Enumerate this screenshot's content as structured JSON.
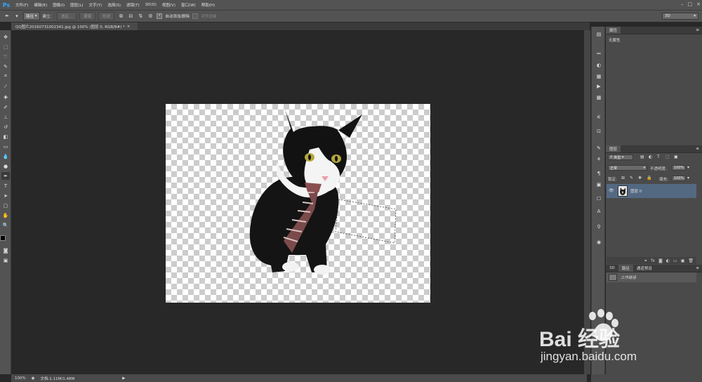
{
  "app": {
    "logo": "Ps"
  },
  "menu": [
    "文件(F)",
    "编辑(E)",
    "图像(I)",
    "图层(L)",
    "文字(Y)",
    "选择(S)",
    "滤镜(T)",
    "3D(D)",
    "视图(V)",
    "窗口(W)",
    "帮助(H)"
  ],
  "window_controls": [
    "–",
    "□",
    "×"
  ],
  "options": {
    "mode_select": "路径",
    "make_label": "建立：",
    "selection_btn": "选区...",
    "mask_btn": "蒙版",
    "shape_btn": "形状",
    "auto_add_label": "自动添加/删除",
    "align_edges_label": "对齐边缘",
    "workspace_select": "3D"
  },
  "document_tab": {
    "title": "QQ图片20160731002341.jpg @ 100% (图层 0, RGB/8#) *",
    "close": "×"
  },
  "properties_panel": {
    "tab": "属性",
    "content": "无属性"
  },
  "layers_panel": {
    "tab": "图层",
    "filter_select": "类型",
    "blend_mode": "正常",
    "opacity_label": "不透明度:",
    "opacity_value": "100%",
    "lock_label": "锁定:",
    "fill_label": "填充:",
    "fill_value": "100%",
    "layers": [
      {
        "name": "图层 0"
      }
    ]
  },
  "paths_panel": {
    "tabs": [
      "3D",
      "路径",
      "通道预设"
    ],
    "items": [
      {
        "name": "工作路径"
      }
    ]
  },
  "status": {
    "zoom": "100%",
    "doc_size": "文档:1.11M/1.48M"
  },
  "watermark": {
    "text": "Bai  经验",
    "url": "jingyan.baidu.com"
  },
  "colors": {
    "accent": "#31a8ff",
    "panel": "#535353",
    "bg": "#282828"
  }
}
